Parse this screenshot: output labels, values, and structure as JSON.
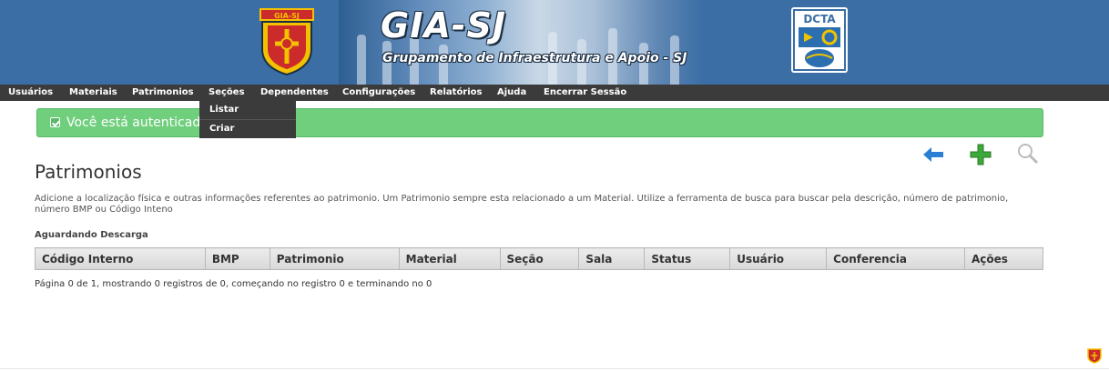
{
  "header": {
    "title": "GIA-SJ",
    "subtitle": "Grupamento de Infraestrutura e Apoio - SJ",
    "shield_label": "GIA-SJ",
    "dcta_label": "DCTA",
    "colors": {
      "banner": "#3a6ea5",
      "shield_red": "#cc2b2b",
      "shield_gold": "#f2c200"
    }
  },
  "nav": {
    "items": [
      "Usuários",
      "Materiais",
      "Patrimonios",
      "Seções",
      "Dependentes",
      "Configurações",
      "Relatórios",
      "Ajuda",
      "Encerrar Sessão"
    ],
    "dropdown": [
      "Listar",
      "Criar"
    ]
  },
  "alert": {
    "text": "Você está autenticado",
    "icon": "check-icon",
    "color": "#6fcf7d"
  },
  "toolbar": {
    "icons": [
      "back-arrow-icon",
      "add-plus-icon",
      "search-icon"
    ]
  },
  "page": {
    "title": "Patrimonios",
    "description": "Adicione a localização física e outras informações referentes ao patrimonio. Um Patrimonio sempre esta relacionado a um Material. Utilize a ferramenta de busca para buscar pela descrição, número de patrimonio, número BMP ou Código Inteno",
    "section": "Aguardando Descarga"
  },
  "table": {
    "columns": [
      "Código Interno",
      "BMP",
      "Patrimonio",
      "Material",
      "Seção",
      "Sala",
      "Status",
      "Usuário",
      "Conferencia",
      "Ações"
    ]
  },
  "pagination": {
    "text": "Página 0 de 1, mostrando 0 registros de 0, começando no registro 0 e terminando no 0"
  }
}
